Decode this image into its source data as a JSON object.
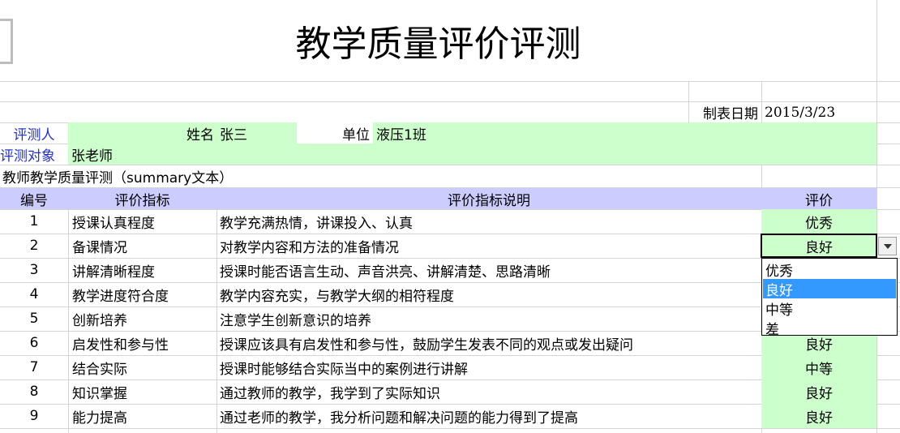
{
  "title": "教学质量评价评测",
  "date": {
    "label": "制表日期",
    "value": "2015/3/23"
  },
  "evaluator": {
    "label": "评测人",
    "name_label": "姓名",
    "name": "张三",
    "unit_label": "单位",
    "unit": "液压1班"
  },
  "subject": {
    "label": "评测对象",
    "value": "张老师"
  },
  "summary": "教师教学质量评测（summary文本）",
  "table": {
    "headers": [
      "编号",
      "评价指标",
      "评价指标说明",
      "评价"
    ],
    "rows": [
      {
        "no": "1",
        "indicator": "授课认真程度",
        "desc": "教学充满热情，讲课投入、认真",
        "rating": "优秀"
      },
      {
        "no": "2",
        "indicator": "备课情况",
        "desc": "对教学内容和方法的准备情况",
        "rating": "良好"
      },
      {
        "no": "3",
        "indicator": "讲解清晰程度",
        "desc": "授课时能否语言生动、声音洪亮、讲解清楚、思路清晰",
        "rating": ""
      },
      {
        "no": "4",
        "indicator": "教学进度符合度",
        "desc": "教学内容充实，与教学大纲的相符程度",
        "rating": ""
      },
      {
        "no": "5",
        "indicator": "创新培养",
        "desc": "注意学生创新意识的培养",
        "rating": ""
      },
      {
        "no": "6",
        "indicator": "启发性和参与性",
        "desc": "授课应该具有启发性和参与性，鼓励学生发表不同的观点或发出疑问",
        "rating": "良好"
      },
      {
        "no": "7",
        "indicator": "结合实际",
        "desc": "授课时能够结合实际当中的案例进行讲解",
        "rating": "中等"
      },
      {
        "no": "8",
        "indicator": "知识掌握",
        "desc": "通过教师的教学，我学到了实际知识",
        "rating": "良好"
      },
      {
        "no": "9",
        "indicator": "能力提高",
        "desc": "通过老师的教学，我分析问题和解决问题的能力得到了提高",
        "rating": "良好"
      }
    ]
  },
  "dropdown": {
    "options": [
      "优秀",
      "良好",
      "中等",
      "差"
    ],
    "selected_index": 1
  },
  "colors": {
    "green": "#ccffcc",
    "header": "#ccccff",
    "label_blue": "#2233cc",
    "selection": "#3399ff"
  }
}
